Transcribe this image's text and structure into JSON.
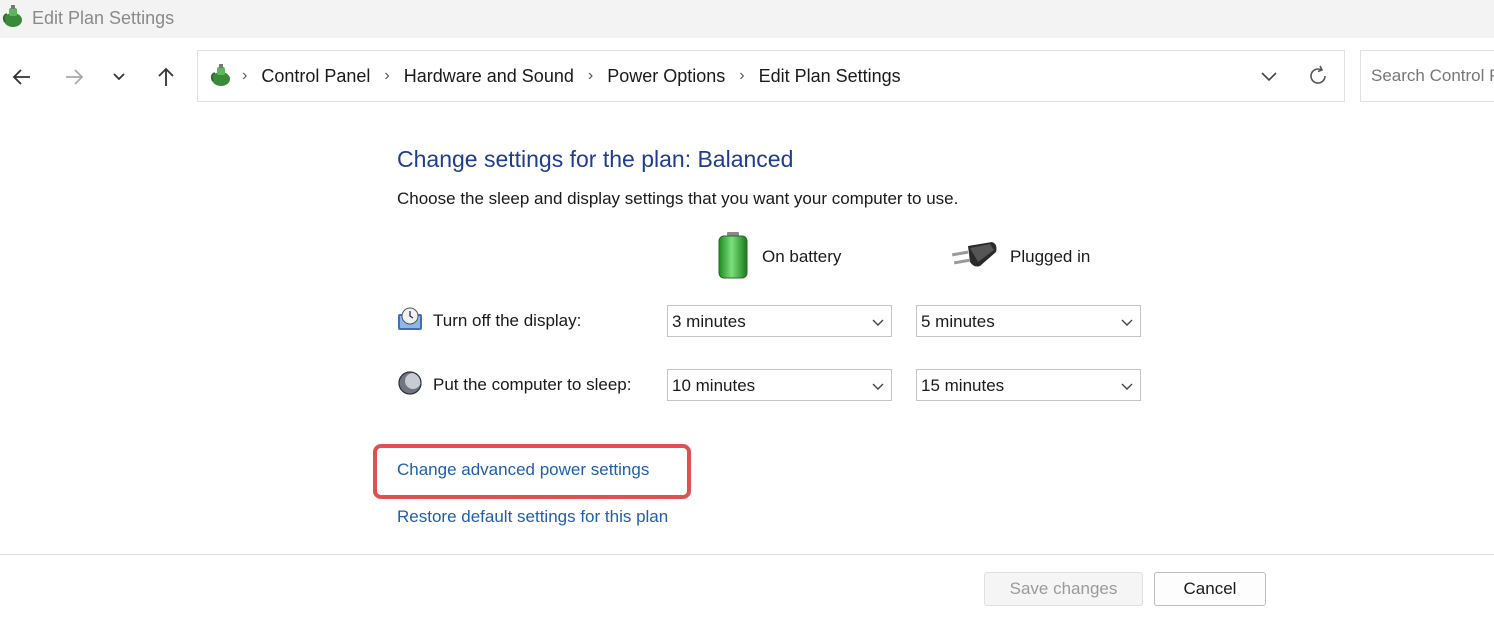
{
  "window": {
    "title": "Edit Plan Settings",
    "app_icon": "power-options-icon"
  },
  "nav": {
    "back_icon": "arrow-left-icon",
    "forward_icon": "arrow-right-icon",
    "recent_icon": "chevron-down-icon",
    "up_icon": "arrow-up-icon"
  },
  "address": {
    "crumbs": [
      "Control Panel",
      "Hardware and Sound",
      "Power Options",
      "Edit Plan Settings"
    ],
    "separator": "›"
  },
  "search": {
    "placeholder": "Search Control Panel"
  },
  "main": {
    "heading": "Change settings for the plan: Balanced",
    "subtitle": "Choose the sleep and display settings that you want your computer to use.",
    "columns": {
      "battery": "On battery",
      "plugged": "Plugged in"
    },
    "rows": [
      {
        "label": "Turn off the display:",
        "battery": "3 minutes",
        "plugged": "5 minutes",
        "icon": "display-icon"
      },
      {
        "label": "Put the computer to sleep:",
        "battery": "10 minutes",
        "plugged": "15 minutes",
        "icon": "sleep-moon-icon"
      }
    ],
    "links": {
      "advanced": "Change advanced power settings",
      "restore": "Restore default settings for this plan"
    }
  },
  "footer": {
    "save": "Save changes",
    "cancel": "Cancel"
  },
  "colors": {
    "heading": "#1e3d8f",
    "link": "#1d5fae",
    "highlight": "#e05050"
  }
}
